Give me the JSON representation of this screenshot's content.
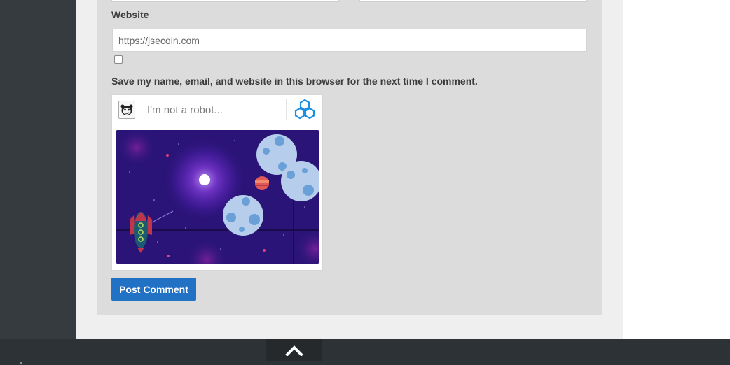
{
  "form": {
    "website_label": "Website",
    "website_value": "https://jsecoin.com",
    "save_label": "Save my name, email, and website in this browser for the next time I comment.",
    "save_checked": false,
    "submit_label": "Post Comment"
  },
  "captcha": {
    "prompt": "I'm not a robot...",
    "logo_icon": "robot-face-icon",
    "brand_icon": "hexagon-cluster-icon",
    "brand_color": "#1e8fe0",
    "game_icons": [
      "rocket-icon",
      "asteroid-icon",
      "planet-icon",
      "sun-icon"
    ]
  },
  "footer": {
    "scroll_top_icon": "chevron-up-icon"
  },
  "colors": {
    "button": "#2171c5",
    "sidebar": "#353b3f",
    "footer": "#2d3236",
    "space_bg": "#2a1478"
  }
}
